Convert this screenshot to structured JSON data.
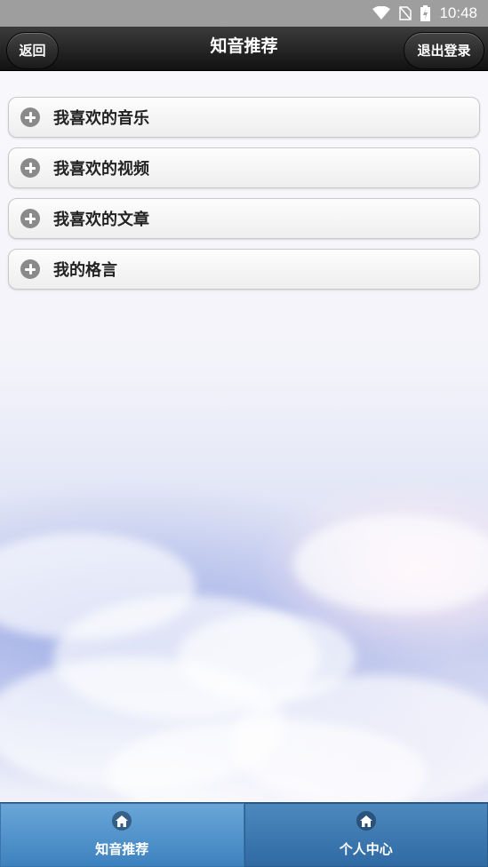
{
  "status_bar": {
    "time": "10:48",
    "icons": [
      "wifi-icon",
      "no-sim-icon",
      "battery-charging-icon"
    ]
  },
  "header": {
    "title": "知音推荐",
    "back_label": "返回",
    "logout_label": "退出登录"
  },
  "list": {
    "items": [
      {
        "label": "我喜欢的音乐",
        "icon": "plus-circle-icon"
      },
      {
        "label": "我喜欢的视频",
        "icon": "plus-circle-icon"
      },
      {
        "label": "我喜欢的文章",
        "icon": "plus-circle-icon"
      },
      {
        "label": "我的格言",
        "icon": "plus-circle-icon"
      }
    ]
  },
  "tabbar": {
    "tabs": [
      {
        "label": "知音推荐",
        "icon": "home-icon",
        "active": true
      },
      {
        "label": "个人中心",
        "icon": "home-icon",
        "active": false
      }
    ]
  },
  "colors": {
    "header_bg": "#1a1a1a",
    "tab_bg": "#2f6aa4",
    "tab_active_bg": "#4d8fca"
  }
}
